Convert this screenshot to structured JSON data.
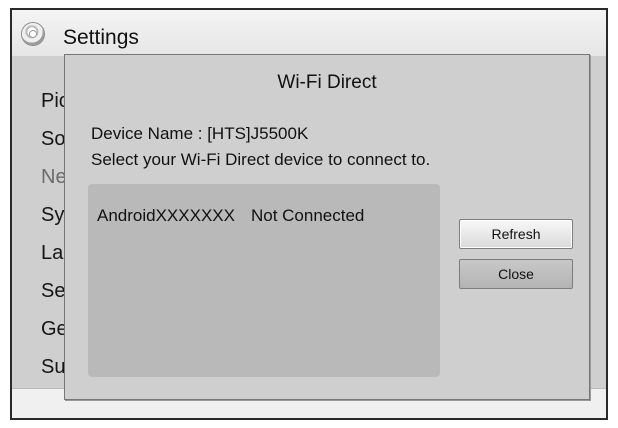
{
  "header": {
    "title": "Settings",
    "icon": "gear-icon"
  },
  "menu": {
    "items": [
      {
        "label": "Picture",
        "dim": false
      },
      {
        "label": "Sound",
        "dim": false
      },
      {
        "label": "Network",
        "dim": true
      },
      {
        "label": "Syste",
        "dim": false
      },
      {
        "label": "Lang",
        "dim": false
      },
      {
        "label": "Secu",
        "dim": false
      },
      {
        "label": "Gene",
        "dim": false
      },
      {
        "label": "Supp",
        "dim": false
      }
    ]
  },
  "dialog": {
    "title": "Wi-Fi Direct",
    "device_name": "Device Name : [HTS]J5500K",
    "instruction": "Select your Wi-Fi Direct device to connect to.",
    "devices": [
      {
        "name": "AndroidXXXXXXX",
        "status": "Not Connected"
      }
    ],
    "buttons": {
      "refresh": "Refresh",
      "close": "Close"
    }
  }
}
